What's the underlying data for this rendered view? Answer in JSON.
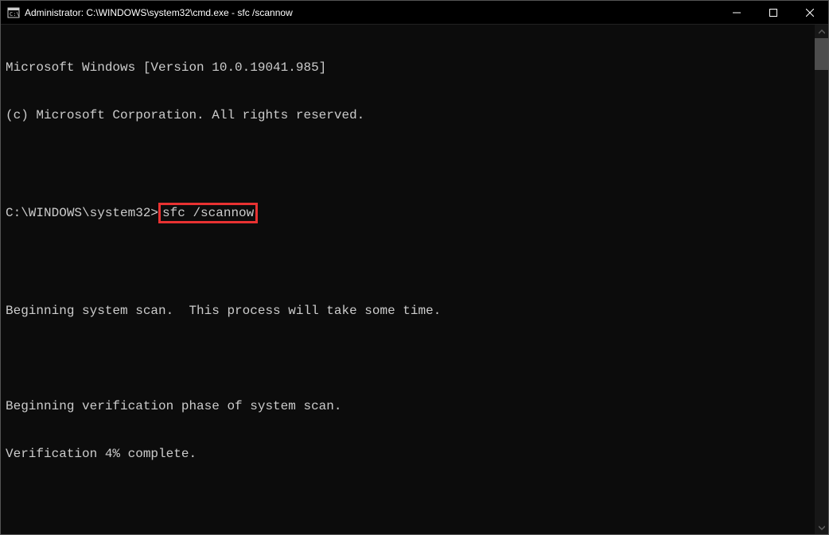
{
  "titlebar": {
    "title": "Administrator: C:\\WINDOWS\\system32\\cmd.exe - sfc  /scannow"
  },
  "terminal": {
    "line1": "Microsoft Windows [Version 10.0.19041.985]",
    "line2": "(c) Microsoft Corporation. All rights reserved.",
    "prompt": "C:\\WINDOWS\\system32>",
    "command": "sfc /scannow",
    "line3": "Beginning system scan.  This process will take some time.",
    "line4": "Beginning verification phase of system scan.",
    "line5": "Verification 4% complete."
  }
}
